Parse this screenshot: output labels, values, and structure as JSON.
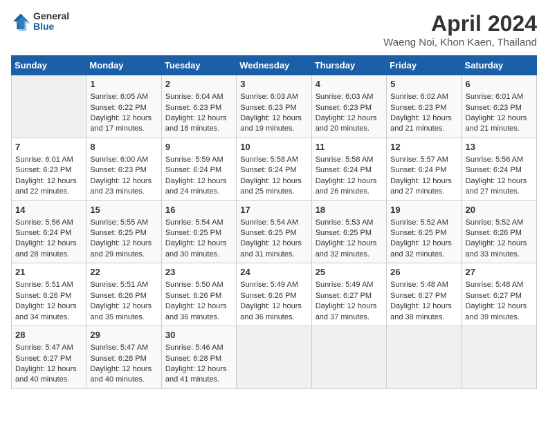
{
  "logo": {
    "general": "General",
    "blue": "Blue"
  },
  "title": "April 2024",
  "subtitle": "Waeng Noi, Khon Kaen, Thailand",
  "headers": [
    "Sunday",
    "Monday",
    "Tuesday",
    "Wednesday",
    "Thursday",
    "Friday",
    "Saturday"
  ],
  "weeks": [
    [
      {
        "day": "",
        "content": ""
      },
      {
        "day": "1",
        "content": "Sunrise: 6:05 AM\nSunset: 6:22 PM\nDaylight: 12 hours\nand 17 minutes."
      },
      {
        "day": "2",
        "content": "Sunrise: 6:04 AM\nSunset: 6:23 PM\nDaylight: 12 hours\nand 18 minutes."
      },
      {
        "day": "3",
        "content": "Sunrise: 6:03 AM\nSunset: 6:23 PM\nDaylight: 12 hours\nand 19 minutes."
      },
      {
        "day": "4",
        "content": "Sunrise: 6:03 AM\nSunset: 6:23 PM\nDaylight: 12 hours\nand 20 minutes."
      },
      {
        "day": "5",
        "content": "Sunrise: 6:02 AM\nSunset: 6:23 PM\nDaylight: 12 hours\nand 21 minutes."
      },
      {
        "day": "6",
        "content": "Sunrise: 6:01 AM\nSunset: 6:23 PM\nDaylight: 12 hours\nand 21 minutes."
      }
    ],
    [
      {
        "day": "7",
        "content": "Sunrise: 6:01 AM\nSunset: 6:23 PM\nDaylight: 12 hours\nand 22 minutes."
      },
      {
        "day": "8",
        "content": "Sunrise: 6:00 AM\nSunset: 6:23 PM\nDaylight: 12 hours\nand 23 minutes."
      },
      {
        "day": "9",
        "content": "Sunrise: 5:59 AM\nSunset: 6:24 PM\nDaylight: 12 hours\nand 24 minutes."
      },
      {
        "day": "10",
        "content": "Sunrise: 5:58 AM\nSunset: 6:24 PM\nDaylight: 12 hours\nand 25 minutes."
      },
      {
        "day": "11",
        "content": "Sunrise: 5:58 AM\nSunset: 6:24 PM\nDaylight: 12 hours\nand 26 minutes."
      },
      {
        "day": "12",
        "content": "Sunrise: 5:57 AM\nSunset: 6:24 PM\nDaylight: 12 hours\nand 27 minutes."
      },
      {
        "day": "13",
        "content": "Sunrise: 5:56 AM\nSunset: 6:24 PM\nDaylight: 12 hours\nand 27 minutes."
      }
    ],
    [
      {
        "day": "14",
        "content": "Sunrise: 5:56 AM\nSunset: 6:24 PM\nDaylight: 12 hours\nand 28 minutes."
      },
      {
        "day": "15",
        "content": "Sunrise: 5:55 AM\nSunset: 6:25 PM\nDaylight: 12 hours\nand 29 minutes."
      },
      {
        "day": "16",
        "content": "Sunrise: 5:54 AM\nSunset: 6:25 PM\nDaylight: 12 hours\nand 30 minutes."
      },
      {
        "day": "17",
        "content": "Sunrise: 5:54 AM\nSunset: 6:25 PM\nDaylight: 12 hours\nand 31 minutes."
      },
      {
        "day": "18",
        "content": "Sunrise: 5:53 AM\nSunset: 6:25 PM\nDaylight: 12 hours\nand 32 minutes."
      },
      {
        "day": "19",
        "content": "Sunrise: 5:52 AM\nSunset: 6:25 PM\nDaylight: 12 hours\nand 32 minutes."
      },
      {
        "day": "20",
        "content": "Sunrise: 5:52 AM\nSunset: 6:26 PM\nDaylight: 12 hours\nand 33 minutes."
      }
    ],
    [
      {
        "day": "21",
        "content": "Sunrise: 5:51 AM\nSunset: 6:26 PM\nDaylight: 12 hours\nand 34 minutes."
      },
      {
        "day": "22",
        "content": "Sunrise: 5:51 AM\nSunset: 6:26 PM\nDaylight: 12 hours\nand 35 minutes."
      },
      {
        "day": "23",
        "content": "Sunrise: 5:50 AM\nSunset: 6:26 PM\nDaylight: 12 hours\nand 36 minutes."
      },
      {
        "day": "24",
        "content": "Sunrise: 5:49 AM\nSunset: 6:26 PM\nDaylight: 12 hours\nand 36 minutes."
      },
      {
        "day": "25",
        "content": "Sunrise: 5:49 AM\nSunset: 6:27 PM\nDaylight: 12 hours\nand 37 minutes."
      },
      {
        "day": "26",
        "content": "Sunrise: 5:48 AM\nSunset: 6:27 PM\nDaylight: 12 hours\nand 38 minutes."
      },
      {
        "day": "27",
        "content": "Sunrise: 5:48 AM\nSunset: 6:27 PM\nDaylight: 12 hours\nand 39 minutes."
      }
    ],
    [
      {
        "day": "28",
        "content": "Sunrise: 5:47 AM\nSunset: 6:27 PM\nDaylight: 12 hours\nand 40 minutes."
      },
      {
        "day": "29",
        "content": "Sunrise: 5:47 AM\nSunset: 6:28 PM\nDaylight: 12 hours\nand 40 minutes."
      },
      {
        "day": "30",
        "content": "Sunrise: 5:46 AM\nSunset: 6:28 PM\nDaylight: 12 hours\nand 41 minutes."
      },
      {
        "day": "",
        "content": ""
      },
      {
        "day": "",
        "content": ""
      },
      {
        "day": "",
        "content": ""
      },
      {
        "day": "",
        "content": ""
      }
    ]
  ]
}
